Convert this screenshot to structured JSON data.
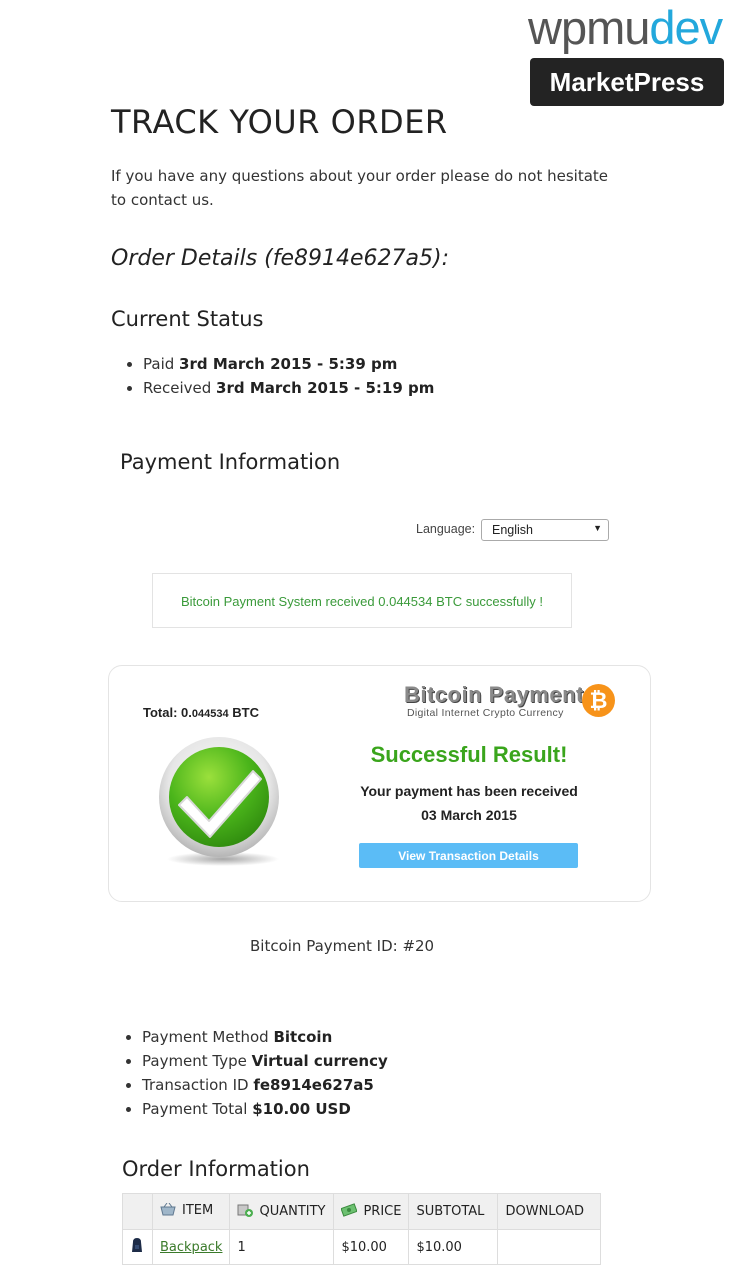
{
  "brand": {
    "wp_part1": "wpmu",
    "wp_part2": "dev",
    "product": "MarketPress"
  },
  "page": {
    "title": "TRACK YOUR ORDER",
    "intro": "If you have any questions about your order please do not hesitate to contact us.",
    "order_details": "Order Details (fe8914e627a5):",
    "current_status_heading": "Current Status",
    "status_items": [
      {
        "label": "Paid",
        "value": "3rd March 2015 - 5:39 pm"
      },
      {
        "label": "Received",
        "value": "3rd March 2015 - 5:19 pm"
      }
    ],
    "payment_info_heading": "Payment Information"
  },
  "language": {
    "label": "Language:",
    "selected": "English"
  },
  "bitcoin": {
    "success_message": "Bitcoin Payment System received 0.044534 BTC successfully !",
    "total_label": "Total:",
    "total_int": "0.",
    "total_dec": "044534",
    "total_unit": "BTC",
    "logo_title": "Bitcoin Payment",
    "logo_subtitle": "Digital Internet Crypto Currency",
    "coin_symbol": "₿",
    "result_title": "Successful Result!",
    "result_line": "Your payment has been received",
    "result_date": "03 March 2015",
    "view_button": "View Transaction Details",
    "payment_id": "Bitcoin Payment ID: #20"
  },
  "payment_details": [
    {
      "label": "Payment Method",
      "value": "Bitcoin"
    },
    {
      "label": "Payment Type",
      "value": "Virtual currency"
    },
    {
      "label": "Transaction ID",
      "value": "fe8914e627a5"
    },
    {
      "label": "Payment Total",
      "value": "$10.00 USD"
    }
  ],
  "order": {
    "heading": "Order Information",
    "columns": [
      "ITEM",
      "QUANTITY",
      "PRICE",
      "SUBTOTAL",
      "DOWNLOAD"
    ],
    "rows": [
      {
        "item": "Backpack",
        "quantity": "1",
        "price": "$10.00",
        "subtotal": "$10.00",
        "download": ""
      }
    ]
  },
  "colors": {
    "accent_blue": "#23a8dc",
    "success_green": "#3aa51c",
    "message_green": "#3a9a3a",
    "button_blue": "#5bbcf6",
    "bitcoin_orange": "#f7931a"
  }
}
